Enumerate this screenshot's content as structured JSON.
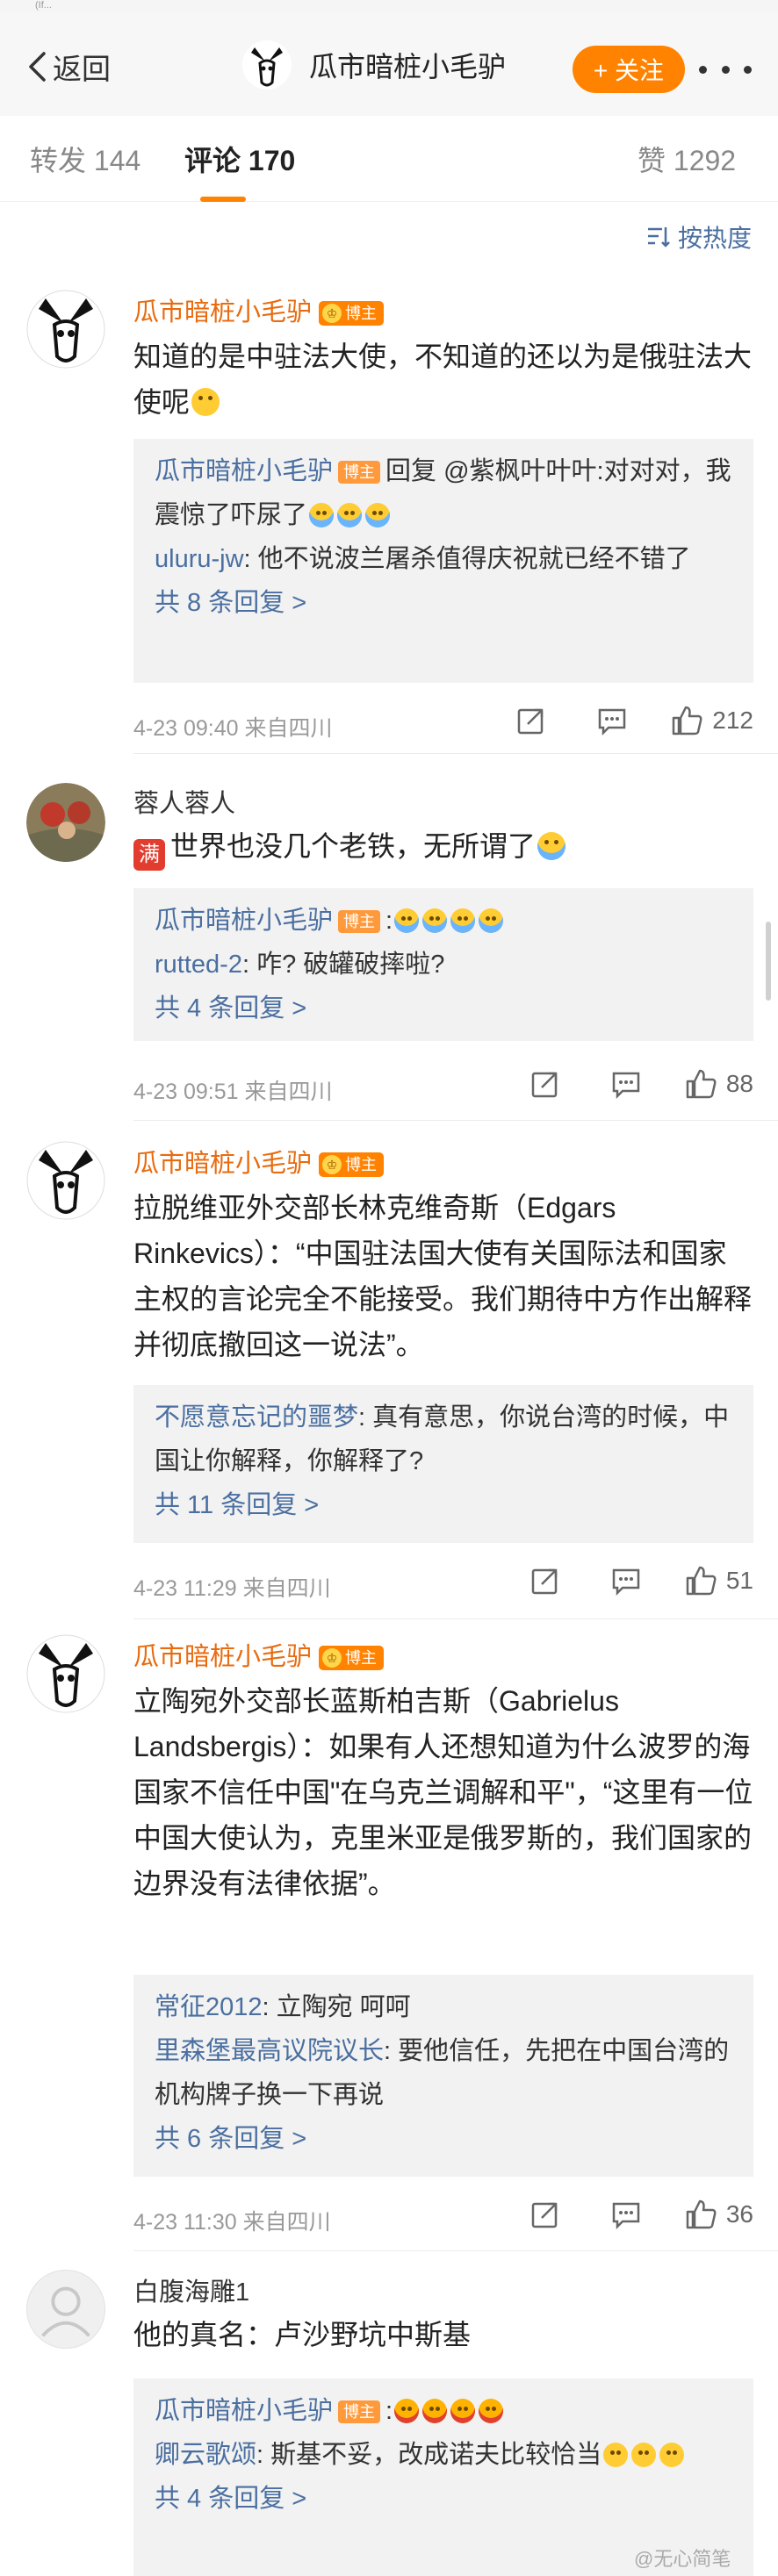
{
  "status": {
    "text": "(If..."
  },
  "header": {
    "back_label": "返回",
    "username": "瓜市暗桩小毛驴",
    "follow_label": "+ 关注"
  },
  "tabs": {
    "repost": "转发 144",
    "comment": "评论 170",
    "likes": "赞 1292"
  },
  "sort": {
    "label": "按热度"
  },
  "comments": [
    {
      "name": "瓜市暗桩小毛驴",
      "badge": "博主",
      "text": "知道的是中驻法大使，不知道的还以为是俄驻法大使呢",
      "replies": [
        {
          "name": "瓜市暗桩小毛驴",
          "badge": "博主",
          "text": "回复 @紫枫叶叶叶:对对对，我震惊了吓尿了"
        },
        {
          "name": "uluru-jw",
          "text": ": 他不说波兰屠杀值得庆祝就已经不错了"
        }
      ],
      "more": "共 8 条回复 >",
      "meta": "4-23 09:40  来自四川",
      "likes": "212"
    },
    {
      "name": "蓉人蓉人",
      "badge_box": "满",
      "text": "世界也没几个老铁，无所谓了",
      "replies": [
        {
          "name": "瓜市暗桩小毛驴",
          "badge": "博主",
          "text": ":"
        },
        {
          "name": "rutted-2",
          "text": ": 咋? 破罐破摔啦?"
        }
      ],
      "more": "共 4 条回复 >",
      "meta": "4-23 09:51  来自四川",
      "likes": "88"
    },
    {
      "name": "瓜市暗桩小毛驴",
      "badge": "博主",
      "text": "拉脱维亚外交部长林克维奇斯（Edgars Rinkevics）：“中国驻法国大使有关国际法和国家主权的言论完全不能接受。我们期待中方作出解释并彻底撤回这一说法”。",
      "replies": [
        {
          "name": "不愿意忘记的噩梦",
          "text": ": 真有意思，你说台湾的时候，中国让你解释，你解释了?"
        }
      ],
      "more": "共 11 条回复 >",
      "meta": "4-23 11:29  来自四川",
      "likes": "51"
    },
    {
      "name": "瓜市暗桩小毛驴",
      "badge": "博主",
      "text": "立陶宛外交部长蓝斯柏吉斯（Gabrielus Landsbergis）：如果有人还想知道为什么波罗的海国家不信任中国\"在乌克兰调解和平\"，“这里有一位中国大使认为，克里米亚是俄罗斯的，我们国家的边界没有法律依据”。",
      "replies": [
        {
          "name": "常征2012",
          "text": ": 立陶宛 呵呵"
        },
        {
          "name": "里森堡最高议院议长",
          "text": ": 要他信任，先把在中国台湾的机构牌子换一下再说"
        }
      ],
      "more": "共 6 条回复 >",
      "meta": "4-23 11:30  来自四川",
      "likes": "36"
    },
    {
      "name": "白腹海雕1",
      "text": "他的真名：卢沙野坑中斯基",
      "replies": [
        {
          "name": "瓜市暗桩小毛驴",
          "badge": "博主",
          "text": ":"
        },
        {
          "name": "卿云歌颂",
          "text": ": 斯基不妥，改成诺夫比较恰当"
        }
      ],
      "more": "共 4 条回复 >"
    }
  ],
  "watermark": "@无心简笔"
}
